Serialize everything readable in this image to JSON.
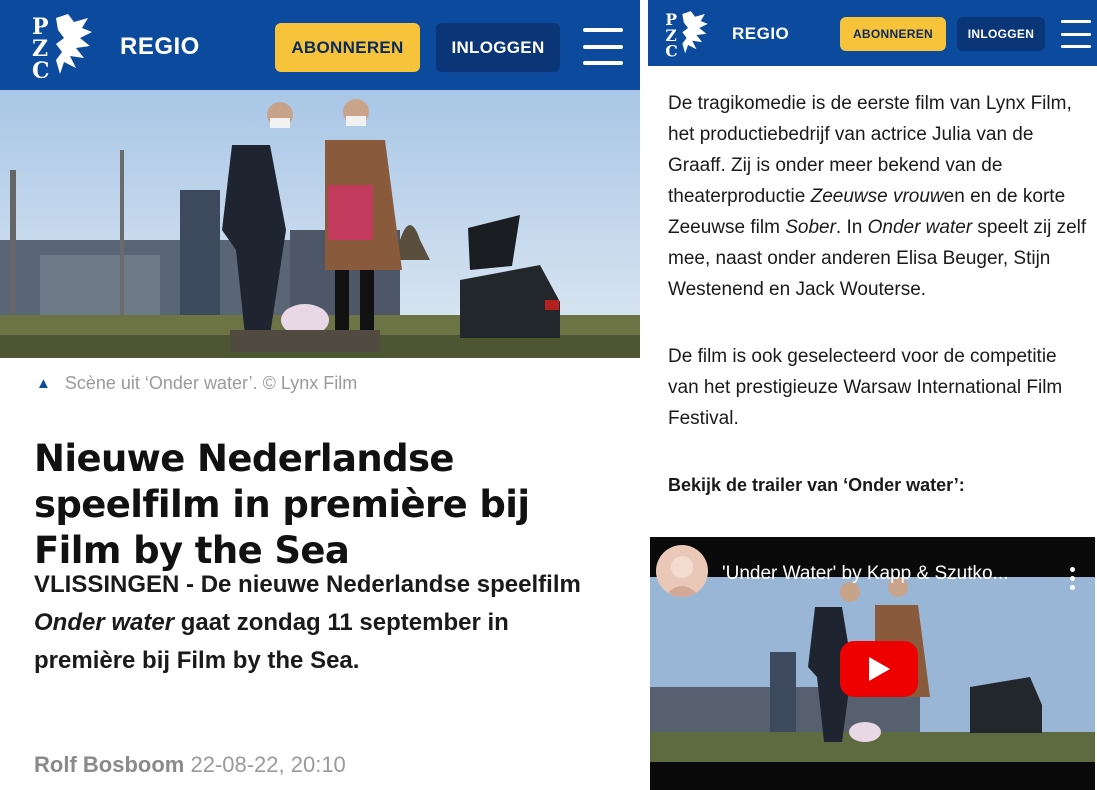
{
  "header": {
    "regio_label": "REGIO",
    "subscribe_label": "ABONNEREN",
    "login_label": "INLOGGEN",
    "brand_color": "#0b4a9c",
    "subscribe_color": "#f6c33b"
  },
  "photo": {
    "caption": "Scène uit ‘Onder water’. © Lynx Film",
    "caption_icon": "triangle-up-icon"
  },
  "article": {
    "headline": "Nieuwe Nederlandse speelfilm in première bij Film by the Sea",
    "intro_lead": "VLISSINGEN - De nieuwe Nederlandse speelfilm ",
    "intro_title": "Onder water",
    "intro_rest": " gaat zondag 11 september in première bij Film by the Sea.",
    "author": "Rolf Bosboom",
    "date": "22-08-22, 20:10"
  },
  "body": {
    "p1": [
      {
        "t": "De tragikomedie is de eerste film van Lynx Film, het productiebedrijf van actrice Julia van de Graaff. Zij is onder meer bekend van de theaterproductie ",
        "i": false
      },
      {
        "t": "Zeeuwse vrouw",
        "i": true
      },
      {
        "t": "en en de korte Zeeuwse film ",
        "i": false
      },
      {
        "t": "Sober",
        "i": true
      },
      {
        "t": ". In ",
        "i": false
      },
      {
        "t": "Onder water",
        "i": true
      },
      {
        "t": " speelt zij zelf mee, naast onder anderen Elisa Beuger, Stijn Westenend en Jack Wouterse.",
        "i": false
      }
    ],
    "p2": "De film is ook geselecteerd voor de competitie van het prestigieuze Warsaw International Film Festival.",
    "p3": "Bekijk de trailer van ‘Onder water’:"
  },
  "video": {
    "title": "'Under Water' by Kapp & Szutko...",
    "play_icon": "youtube-play-icon",
    "menu_icon": "kebab-menu-icon"
  }
}
